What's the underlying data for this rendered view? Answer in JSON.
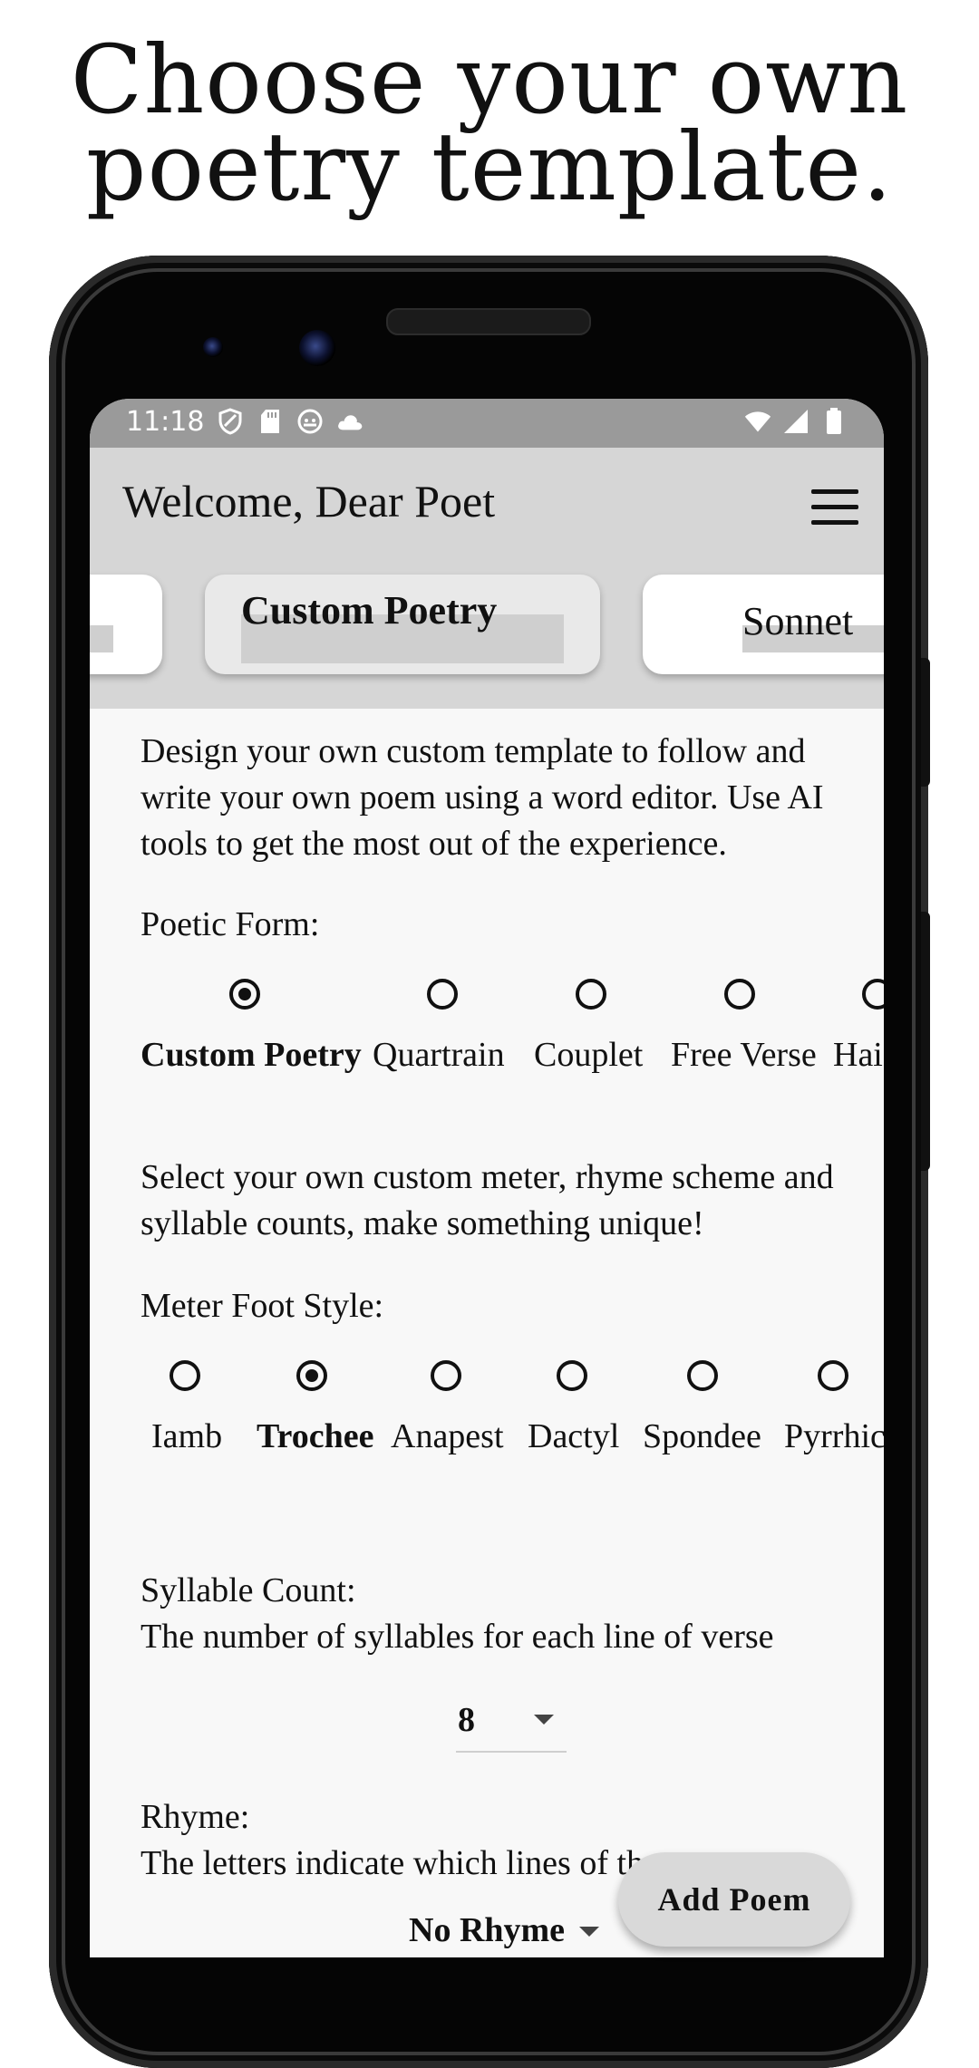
{
  "headline": {
    "line1": "Choose your own",
    "line2": "poetry template."
  },
  "status_bar": {
    "time": "11:18",
    "left_icons": [
      "shield-icon",
      "sd-card-icon",
      "android-icon",
      "cloud-icon"
    ],
    "right_icons": [
      "wifi-icon",
      "signal-icon",
      "battery-icon"
    ]
  },
  "app_bar": {
    "title": "Welcome, Dear Poet",
    "menu_icon": "hamburger-menu-icon"
  },
  "tabs": [
    {
      "label": ""
    },
    {
      "label": "Custom Poetry",
      "selected": true
    },
    {
      "label": "Sonnet"
    }
  ],
  "intro": "Design your own custom template to follow and write your own poem using a word editor. Use AI tools to get the most out of the experience.",
  "poetic_form": {
    "label": "Poetic Form:",
    "options": [
      "Custom Poetry",
      "Quartrain",
      "Couplet",
      "Free Verse",
      "Hai"
    ],
    "selected": "Custom Poetry"
  },
  "custom_description": "Select your own custom meter, rhyme scheme and syllable counts, make something unique!",
  "meter_foot": {
    "label": "Meter Foot Style:",
    "options": [
      "Iamb",
      "Trochee",
      "Anapest",
      "Dactyl",
      "Spondee",
      "Pyrrhic"
    ],
    "selected": "Trochee"
  },
  "syllable_count": {
    "label": "Syllable Count:",
    "description": "The number of syllables for each line of verse",
    "value": "8"
  },
  "rhyme": {
    "label": "Rhyme:",
    "description": "The letters indicate which lines of th",
    "value": "No Rhyme"
  },
  "fab_label": "Add Poem"
}
